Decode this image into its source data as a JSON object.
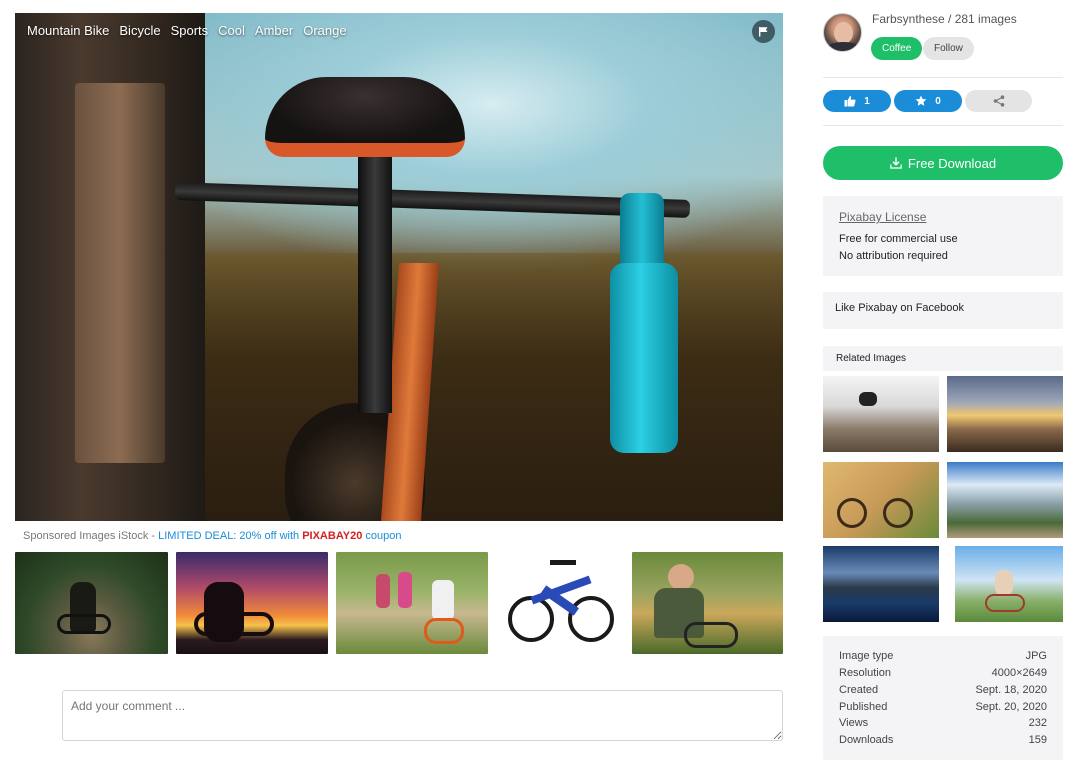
{
  "image": {
    "tags": [
      "Mountain Bike",
      "Bicycle",
      "Sports",
      "Cool",
      "Amber",
      "Orange"
    ],
    "flag_icon": "flag-icon"
  },
  "sponsored": {
    "prefix": "Sponsored Images iStock - ",
    "deal": "LIMITED DEAL: 20% off with ",
    "code": "PIXABAY20",
    "suffix": " coupon"
  },
  "comment": {
    "placeholder": "Add your comment ..."
  },
  "author": {
    "name_line": "Farbsynthese / 281 images",
    "coffee_label": "Coffee",
    "follow_label": "Follow"
  },
  "actions": {
    "likes": "1",
    "favorites": "0",
    "like_icon": "thumbs-up-icon",
    "fav_icon": "star-icon",
    "share_icon": "share-icon"
  },
  "download": {
    "label": "Free Download",
    "icon": "download-icon"
  },
  "license": {
    "title": "Pixabay License",
    "line1": "Free for commercial use",
    "line2": "No attribution required"
  },
  "facebook": {
    "label": "Like Pixabay on Facebook"
  },
  "related": {
    "title": "Related Images"
  },
  "meta": [
    {
      "key": "Image type",
      "value": "JPG"
    },
    {
      "key": "Resolution",
      "value": "4000×2649"
    },
    {
      "key": "Created",
      "value": "Sept. 18, 2020"
    },
    {
      "key": "Published",
      "value": "Sept. 20, 2020"
    },
    {
      "key": "Views",
      "value": "232"
    },
    {
      "key": "Downloads",
      "value": "159"
    }
  ],
  "colors": {
    "green": "#1fbf6a",
    "blue": "#1a8cd8",
    "red_code": "#d42020"
  }
}
